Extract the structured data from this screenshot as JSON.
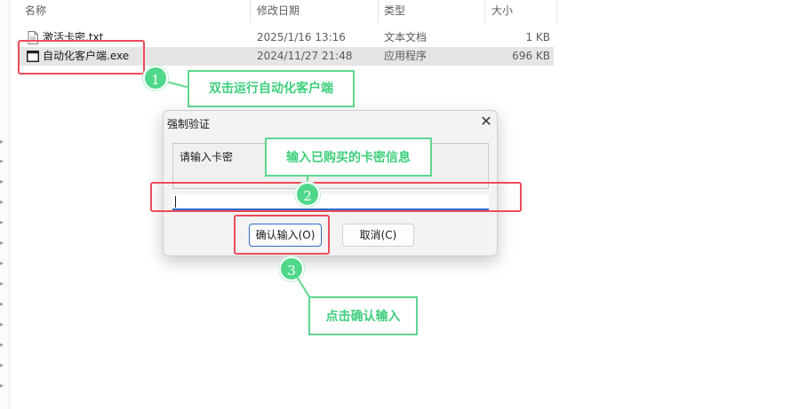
{
  "columns": {
    "name": "名称",
    "modified": "修改日期",
    "type": "类型",
    "size": "大小"
  },
  "files": [
    {
      "name": "激活卡密.txt",
      "modified": "2025/1/16 13:16",
      "type": "文本文档",
      "size": "1 KB",
      "icon": "text-file-icon"
    },
    {
      "name": "自动化客户端.exe",
      "modified": "2024/11/27 21:48",
      "type": "应用程序",
      "size": "696 KB",
      "icon": "app-exe-icon"
    }
  ],
  "dialog": {
    "title": "强制验证",
    "close_glyph": "✕",
    "prompt": "请输入卡密",
    "input_value": "",
    "confirm_label": "确认输入(O)",
    "cancel_label": "取消(C)"
  },
  "steps": [
    {
      "number": "1",
      "text": "双击运行自动化客户端"
    },
    {
      "number": "2",
      "text": "输入已购买的卡密信息"
    },
    {
      "number": "3",
      "text": "点击确认输入"
    }
  ],
  "colors": {
    "highlight_red": "#ee4b5a",
    "callout_green": "#5fd68f",
    "focus_blue": "#2d6bc9"
  }
}
